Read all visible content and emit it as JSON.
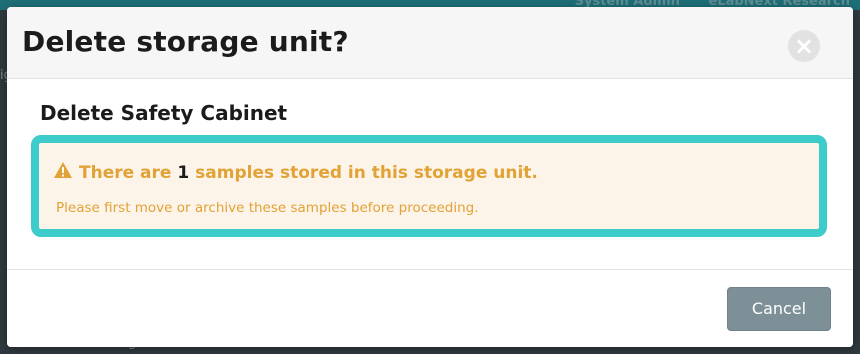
{
  "background": {
    "top_right_text": [
      "System Admin",
      "eLabNext Research"
    ]
  },
  "modal": {
    "title": "Delete storage unit?",
    "close_symbol": "×",
    "subtitle": "Delete Safety Cabinet",
    "alert": {
      "icon": "warning-triangle-icon",
      "line1_prefix": "There are",
      "sample_count": "1",
      "line1_suffix": "samples stored in this storage unit.",
      "line2": "Please first move or archive these samples before proceeding.",
      "text_color": "#e1a236",
      "background_color": "#fdf4e9",
      "highlight_color": "#3ecccb"
    },
    "footer": {
      "cancel_label": "Cancel",
      "cancel_color": "#7d9098"
    }
  }
}
